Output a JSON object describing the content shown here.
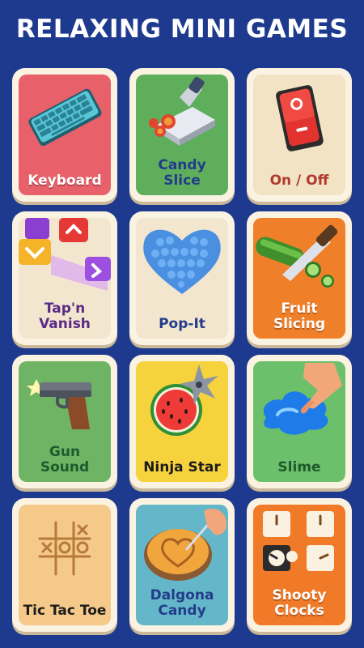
{
  "title": "RELAXING MINI GAMES",
  "colors": {
    "background": "#1e3a8f",
    "card_frame": "#fbf3e2"
  },
  "games": [
    {
      "label": "Keyboard",
      "tile_color": "#e8606a",
      "icon": "keyboard-icon"
    },
    {
      "label": "Candy\nSlice",
      "tile_color": "#5fae5c",
      "icon": "knife-slicing-candy-icon"
    },
    {
      "label": "On / Off",
      "tile_color": "#f1e3c4",
      "icon": "power-switch-icon"
    },
    {
      "label": "Tap'n\nVanish",
      "tile_color": "#f3e6cf",
      "icon": "arrow-blocks-icon"
    },
    {
      "label": "Pop-It",
      "tile_color": "#f3e6cf",
      "icon": "heart-pop-it-icon"
    },
    {
      "label": "Fruit\nSlicing",
      "tile_color": "#f07f2a",
      "icon": "cucumber-knife-icon"
    },
    {
      "label": "Gun\nSound",
      "tile_color": "#6eb464",
      "icon": "pistol-icon"
    },
    {
      "label": "Ninja Star",
      "tile_color": "#f6d23c",
      "icon": "watermelon-shuriken-icon"
    },
    {
      "label": "Slime",
      "tile_color": "#6cc06b",
      "icon": "slime-hand-icon"
    },
    {
      "label": "Tic Tac Toe",
      "tile_color": "#f4c98a",
      "icon": "tic-tac-toe-icon"
    },
    {
      "label": "Dalgona\nCandy",
      "tile_color": "#64b7c9",
      "icon": "dalgona-heart-icon"
    },
    {
      "label": "Shooty\nClocks",
      "tile_color": "#f07a28",
      "icon": "clocks-icon"
    }
  ]
}
